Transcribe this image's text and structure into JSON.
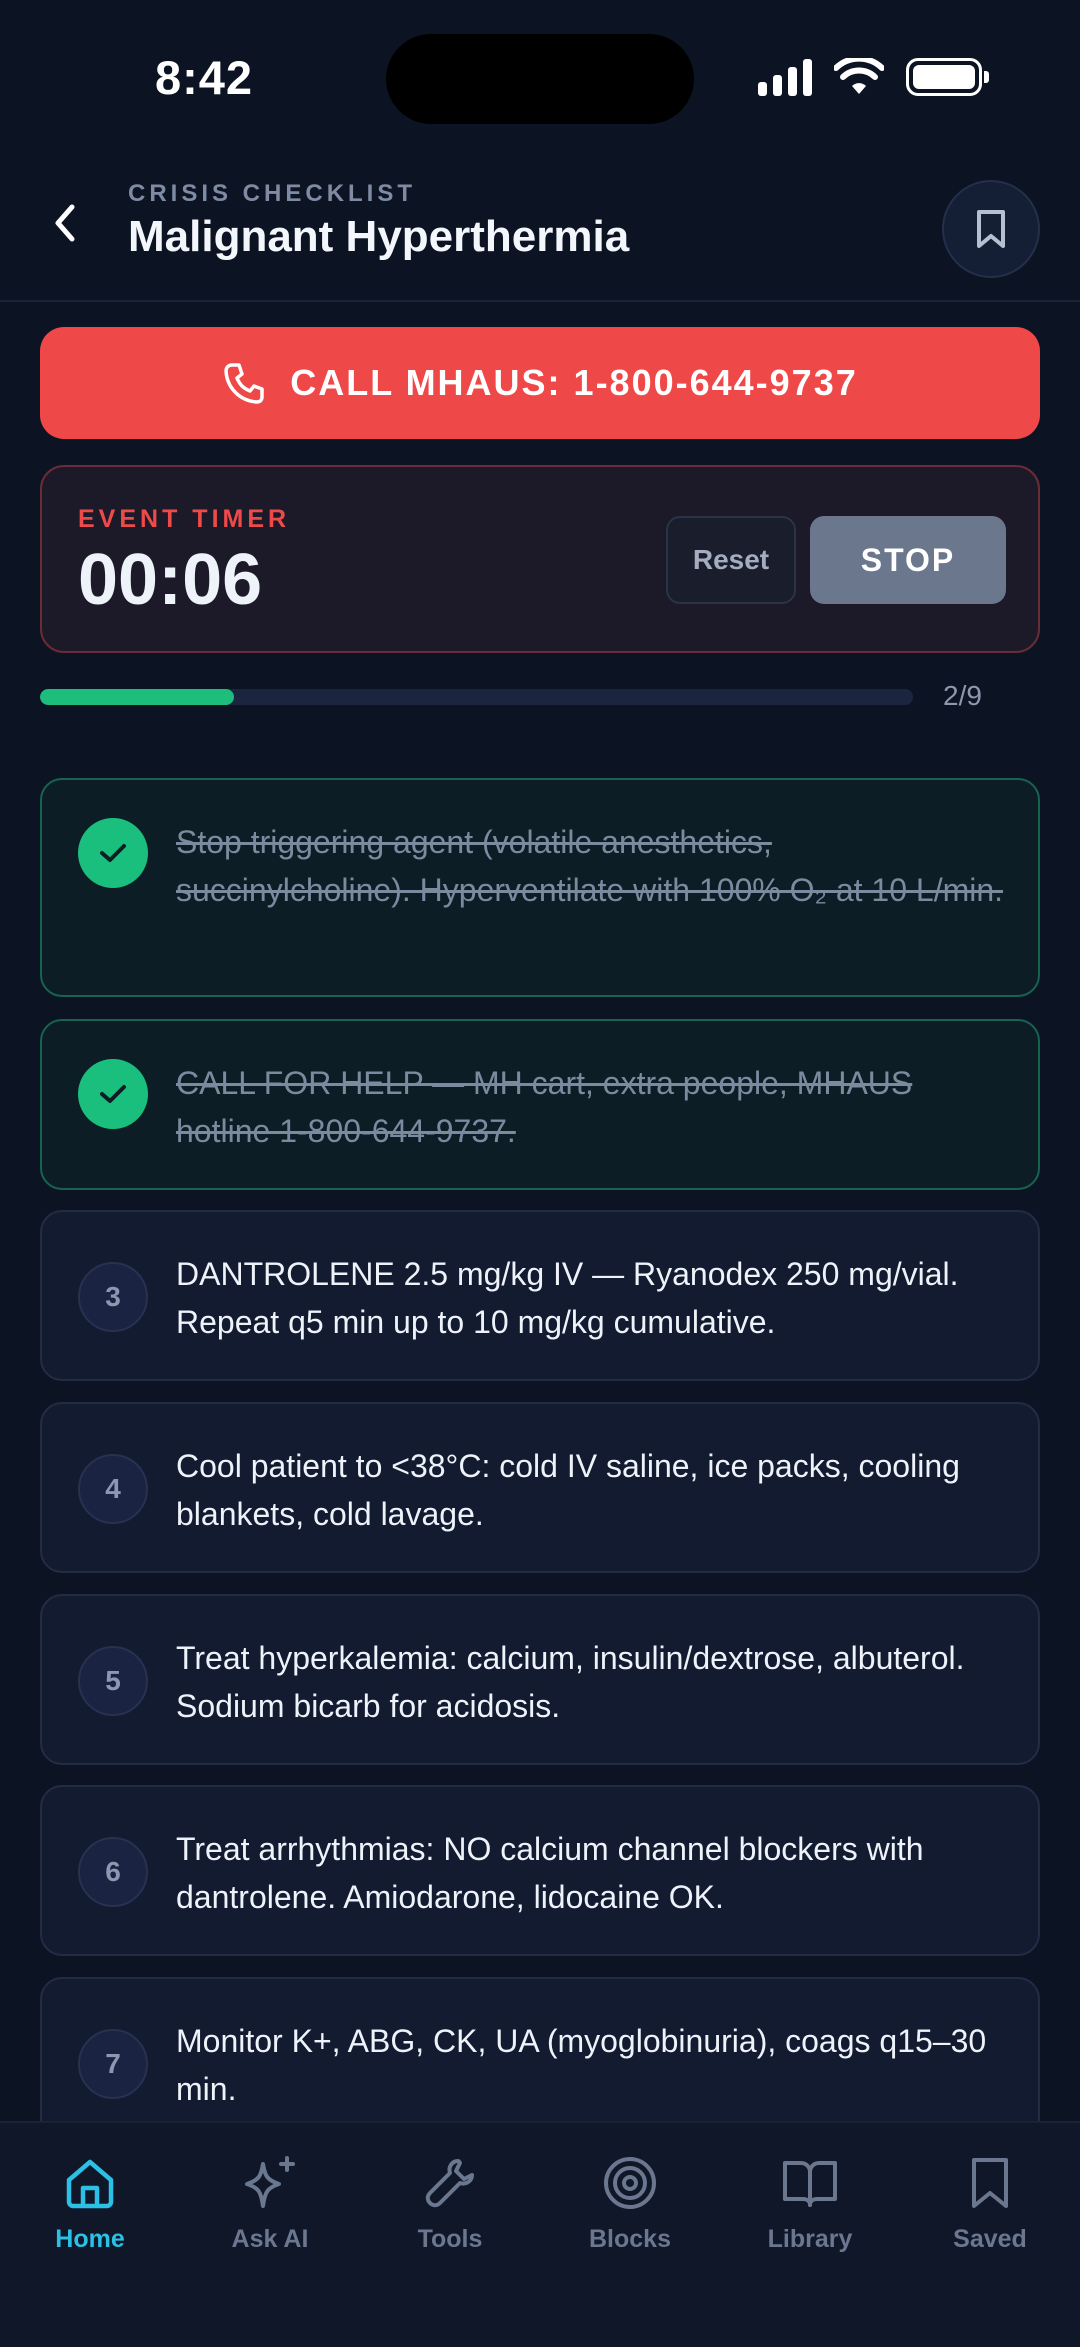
{
  "status_bar": {
    "time": "8:42"
  },
  "header": {
    "eyebrow": "CRISIS CHECKLIST",
    "title": "Malignant Hyperthermia"
  },
  "call_button": {
    "label": "CALL MHAUS: 1-800-644-9737"
  },
  "timer": {
    "eyebrow": "EVENT TIMER",
    "value": "00:06",
    "reset_label": "Reset",
    "stop_label": "STOP"
  },
  "progress": {
    "completed": 2,
    "total": 9,
    "label": "2/9"
  },
  "checklist": [
    {
      "number": "1",
      "done": true,
      "text": "Stop triggering agent (volatile anesthetics, succinylcholine). Hyperventilate with 100% O₂ at 10 L/min."
    },
    {
      "number": "2",
      "done": true,
      "text": "CALL FOR HELP — MH cart, extra people, MHAUS hotline 1-800-644-9737."
    },
    {
      "number": "3",
      "done": false,
      "text": "DANTROLENE 2.5 mg/kg IV — Ryanodex 250 mg/vial. Repeat q5 min up to 10 mg/kg cumulative."
    },
    {
      "number": "4",
      "done": false,
      "text": "Cool patient to <38°C: cold IV saline, ice packs, cooling blankets, cold lavage."
    },
    {
      "number": "5",
      "done": false,
      "text": "Treat hyperkalemia: calcium, insulin/dextrose, albuterol. Sodium bicarb for acidosis."
    },
    {
      "number": "6",
      "done": false,
      "text": "Treat arrhythmias: NO calcium channel blockers with dantrolene. Amiodarone, lidocaine OK."
    },
    {
      "number": "7",
      "done": false,
      "text": "Monitor K+, ABG, CK, UA (myoglobinuria), coags q15–30 min."
    }
  ],
  "nav": [
    {
      "label": "Home",
      "icon": "home-icon",
      "active": true
    },
    {
      "label": "Ask AI",
      "icon": "sparkle-icon",
      "active": false
    },
    {
      "label": "Tools",
      "icon": "wrench-icon",
      "active": false
    },
    {
      "label": "Blocks",
      "icon": "target-icon",
      "active": false
    },
    {
      "label": "Library",
      "icon": "book-icon",
      "active": false
    },
    {
      "label": "Saved",
      "icon": "bookmark-icon",
      "active": false
    }
  ],
  "colors": {
    "background": "#0c1424",
    "call": "#ef4848",
    "timer_accent": "#ef4a4a",
    "progress": "#1dbe7c",
    "done_badge": "#1bbf7d",
    "nav_active": "#2bc0e4"
  }
}
